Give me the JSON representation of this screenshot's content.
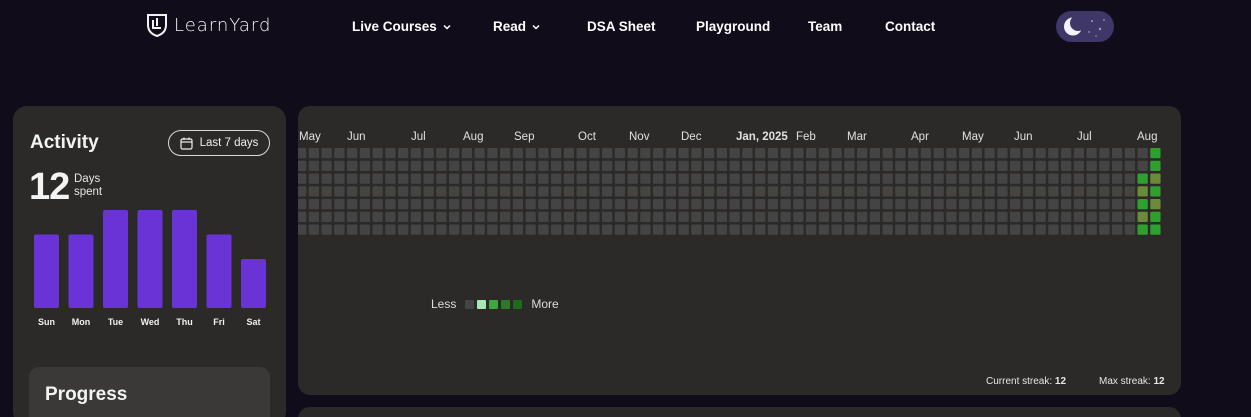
{
  "nav": {
    "logo_text": "LearnYard",
    "items": [
      {
        "label": "Live Courses",
        "has_dropdown": true
      },
      {
        "label": "Read",
        "has_dropdown": true
      },
      {
        "label": "DSA Sheet",
        "has_dropdown": false
      },
      {
        "label": "Playground",
        "has_dropdown": false
      },
      {
        "label": "Team",
        "has_dropdown": false
      },
      {
        "label": "Contact",
        "has_dropdown": false
      }
    ],
    "theme_toggle_icon": "moon-icon"
  },
  "activity": {
    "title": "Activity",
    "range_label": "Last 7 days",
    "range_icon": "calendar-icon",
    "days_value": "12",
    "days_label": "Days spent",
    "progress_title": "Progress"
  },
  "chart_data": {
    "type": "bar",
    "categories": [
      "Sun",
      "Mon",
      "Tue",
      "Wed",
      "Thu",
      "Fri",
      "Sat"
    ],
    "values": [
      3,
      3,
      4,
      4,
      4,
      3,
      2
    ],
    "ylim": [
      0,
      4
    ],
    "bar_color": "#6a33d6",
    "title": "",
    "xlabel": "",
    "ylabel": ""
  },
  "heatmap": {
    "month_labels": [
      "May",
      "Jun",
      "Jul",
      "Aug",
      "Sep",
      "Oct",
      "Nov",
      "Dec",
      "Jan, 2025",
      "Feb",
      "Mar",
      "Apr",
      "May",
      "Jun",
      "Jul",
      "Aug"
    ],
    "weeks": 68,
    "legend_less": "Less",
    "legend_more": "More",
    "legend_colors": [
      "#444444",
      "#a8e6b6",
      "#3aa83a",
      "#2a7a2a",
      "#1d6b1d"
    ],
    "empty_color": "#444444",
    "active_cells": [
      {
        "week": 67,
        "day": 0,
        "level": "#2fa02f"
      },
      {
        "week": 67,
        "day": 1,
        "level": "#2fa02f"
      },
      {
        "week": 66,
        "day": 2,
        "level": "#2fa02f"
      },
      {
        "week": 67,
        "day": 2,
        "level": "#6b8a3a"
      },
      {
        "week": 66,
        "day": 3,
        "level": "#6b8a3a"
      },
      {
        "week": 67,
        "day": 3,
        "level": "#2fa02f"
      },
      {
        "week": 66,
        "day": 4,
        "level": "#2fa02f"
      },
      {
        "week": 67,
        "day": 4,
        "level": "#6b8a3a"
      },
      {
        "week": 66,
        "day": 5,
        "level": "#6b8a3a"
      },
      {
        "week": 67,
        "day": 5,
        "level": "#2fa02f"
      },
      {
        "week": 66,
        "day": 6,
        "level": "#2fa02f"
      },
      {
        "week": 67,
        "day": 6,
        "level": "#2fa02f"
      }
    ],
    "current_streak_label": "Current streak:",
    "current_streak_value": "12",
    "max_streak_label": "Max streak:",
    "max_streak_value": "12"
  }
}
